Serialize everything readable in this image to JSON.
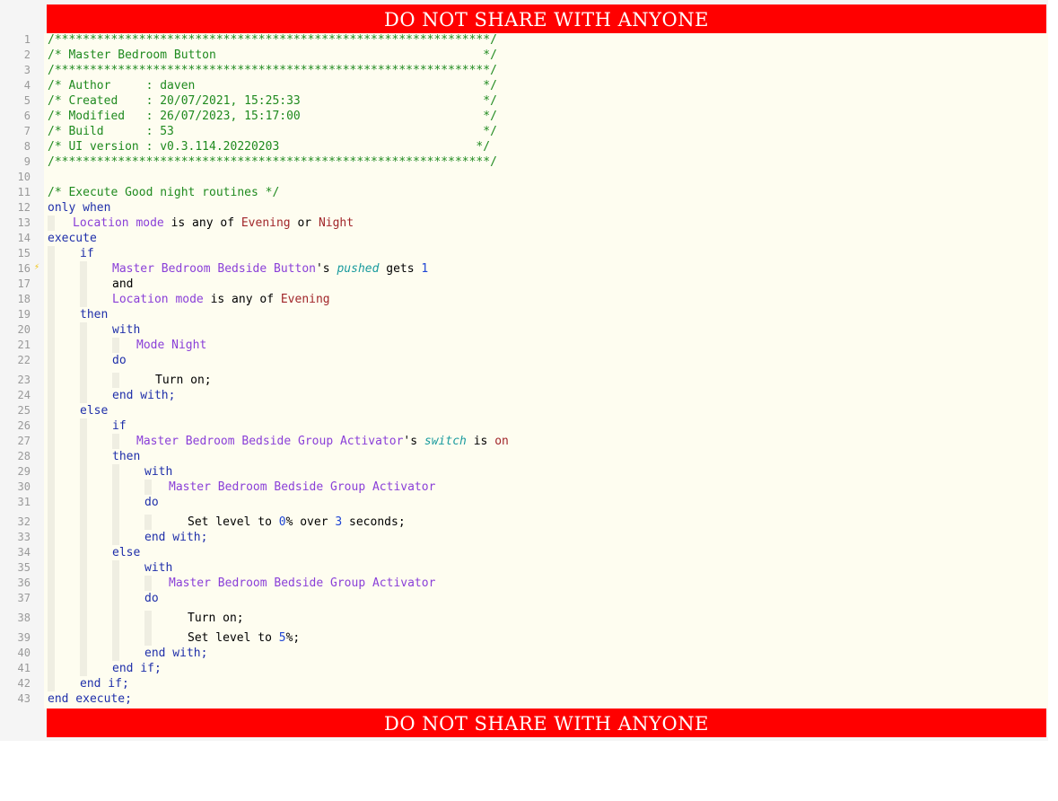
{
  "banner": {
    "top": "DO NOT SHARE WITH ANYONE",
    "bottom": "DO NOT SHARE WITH ANYONE"
  },
  "colors": {
    "banner": "#ff0000",
    "code_background": "#fefdf0",
    "comment": "#1f8a1f",
    "keyword": "#1f2faa",
    "device": "#8a3fd8",
    "value": "#a1262a",
    "attribute": "#1a9b9e",
    "number": "#1f45d4",
    "text": "#000000"
  },
  "gutter_marker": {
    "line": 16,
    "icon": "lightbulb-icon"
  },
  "lines": [
    {
      "n": "1",
      "indent": 0,
      "tokens": [
        {
          "t": "/**************************************************************/",
          "c": "com"
        }
      ]
    },
    {
      "n": "2",
      "indent": 0,
      "tokens": [
        {
          "t": "/* Master Bedroom Button                                      */",
          "c": "com"
        }
      ]
    },
    {
      "n": "3",
      "indent": 0,
      "tokens": [
        {
          "t": "/**************************************************************/",
          "c": "com"
        }
      ]
    },
    {
      "n": "4",
      "indent": 0,
      "tokens": [
        {
          "t": "/* Author     : daven                                         */",
          "c": "com"
        }
      ]
    },
    {
      "n": "5",
      "indent": 0,
      "tokens": [
        {
          "t": "/* Created    : 20/07/2021, 15:25:33                          */",
          "c": "com"
        }
      ]
    },
    {
      "n": "6",
      "indent": 0,
      "tokens": [
        {
          "t": "/* Modified   : 26/07/2023, 15:17:00                          */",
          "c": "com"
        }
      ]
    },
    {
      "n": "7",
      "indent": 0,
      "tokens": [
        {
          "t": "/* Build      : 53                                            */",
          "c": "com"
        }
      ]
    },
    {
      "n": "8",
      "indent": 0,
      "tokens": [
        {
          "t": "/* UI version : v0.3.114.20220203                            */",
          "c": "com"
        }
      ]
    },
    {
      "n": "9",
      "indent": 0,
      "tokens": [
        {
          "t": "/**************************************************************/",
          "c": "com"
        }
      ]
    },
    {
      "n": "10",
      "indent": 0,
      "tokens": []
    },
    {
      "n": "11",
      "indent": 0,
      "tokens": [
        {
          "t": "/* Execute Good night routines */",
          "c": "com"
        }
      ]
    },
    {
      "n": "12",
      "indent": 0,
      "tokens": [
        {
          "t": "only when",
          "c": "kw"
        }
      ]
    },
    {
      "n": "13",
      "indent": 1,
      "tokens": [
        {
          "t": "Location mode",
          "c": "dev"
        },
        {
          "t": " is any of ",
          "c": "txt"
        },
        {
          "t": "Evening",
          "c": "val"
        },
        {
          "t": " or ",
          "c": "txt"
        },
        {
          "t": "Night",
          "c": "val"
        }
      ]
    },
    {
      "n": "14",
      "indent": 0,
      "tokens": [
        {
          "t": "execute",
          "c": "kw"
        }
      ]
    },
    {
      "n": "15",
      "indent": 1,
      "tokens": [
        {
          "t": "if",
          "c": "kw"
        }
      ]
    },
    {
      "n": "16",
      "indent": 2,
      "tokens": [
        {
          "t": "Master Bedroom Bedside Button",
          "c": "dev"
        },
        {
          "t": "'s ",
          "c": "txt"
        },
        {
          "t": "pushed",
          "c": "attr"
        },
        {
          "t": " gets ",
          "c": "txt"
        },
        {
          "t": "1",
          "c": "num"
        }
      ]
    },
    {
      "n": "17",
      "indent": 2,
      "tokens": [
        {
          "t": "and",
          "c": "txt"
        }
      ]
    },
    {
      "n": "18",
      "indent": 2,
      "tokens": [
        {
          "t": "Location mode",
          "c": "dev"
        },
        {
          "t": " is any of ",
          "c": "txt"
        },
        {
          "t": "Evening",
          "c": "val"
        }
      ]
    },
    {
      "n": "19",
      "indent": 1,
      "tokens": [
        {
          "t": "then",
          "c": "kw"
        }
      ]
    },
    {
      "n": "20",
      "indent": 2,
      "tokens": [
        {
          "t": "with",
          "c": "kw"
        }
      ]
    },
    {
      "n": "21",
      "indent": 3,
      "tokens": [
        {
          "t": "Mode Night",
          "c": "dev"
        }
      ]
    },
    {
      "n": "22",
      "indent": 2,
      "tokens": [
        {
          "t": "do",
          "c": "kw"
        }
      ]
    },
    {
      "n": "23",
      "indent": 3,
      "tall": true,
      "tokens": [
        {
          "t": "Turn on;",
          "c": "txt"
        }
      ]
    },
    {
      "n": "24",
      "indent": 2,
      "tokens": [
        {
          "t": "end with;",
          "c": "kw"
        }
      ]
    },
    {
      "n": "25",
      "indent": 1,
      "tokens": [
        {
          "t": "else",
          "c": "kw"
        }
      ]
    },
    {
      "n": "26",
      "indent": 2,
      "tokens": [
        {
          "t": "if",
          "c": "kw"
        }
      ]
    },
    {
      "n": "27",
      "indent": 3,
      "tokens": [
        {
          "t": "Master Bedroom Bedside Group Activator",
          "c": "dev"
        },
        {
          "t": "'s ",
          "c": "txt"
        },
        {
          "t": "switch",
          "c": "attr"
        },
        {
          "t": " is ",
          "c": "txt"
        },
        {
          "t": "on",
          "c": "val"
        }
      ]
    },
    {
      "n": "28",
      "indent": 2,
      "tokens": [
        {
          "t": "then",
          "c": "kw"
        }
      ]
    },
    {
      "n": "29",
      "indent": 3,
      "tokens": [
        {
          "t": "with",
          "c": "kw"
        }
      ]
    },
    {
      "n": "30",
      "indent": 4,
      "tokens": [
        {
          "t": "Master Bedroom Bedside Group Activator",
          "c": "dev"
        }
      ]
    },
    {
      "n": "31",
      "indent": 3,
      "tokens": [
        {
          "t": "do",
          "c": "kw"
        }
      ]
    },
    {
      "n": "32",
      "indent": 4,
      "tall": true,
      "tokens": [
        {
          "t": "Set level to ",
          "c": "txt"
        },
        {
          "t": "0",
          "c": "num"
        },
        {
          "t": "% over ",
          "c": "txt"
        },
        {
          "t": "3",
          "c": "num"
        },
        {
          "t": " seconds;",
          "c": "txt"
        }
      ]
    },
    {
      "n": "33",
      "indent": 3,
      "tokens": [
        {
          "t": "end with;",
          "c": "kw"
        }
      ]
    },
    {
      "n": "34",
      "indent": 2,
      "tokens": [
        {
          "t": "else",
          "c": "kw"
        }
      ]
    },
    {
      "n": "35",
      "indent": 3,
      "tokens": [
        {
          "t": "with",
          "c": "kw"
        }
      ]
    },
    {
      "n": "36",
      "indent": 4,
      "tokens": [
        {
          "t": "Master Bedroom Bedside Group Activator",
          "c": "dev"
        }
      ]
    },
    {
      "n": "37",
      "indent": 3,
      "tokens": [
        {
          "t": "do",
          "c": "kw"
        }
      ]
    },
    {
      "n": "38",
      "indent": 4,
      "tall": true,
      "tokens": [
        {
          "t": "Turn on;",
          "c": "txt"
        }
      ]
    },
    {
      "n": "39",
      "indent": 4,
      "tall": true,
      "tokens": [
        {
          "t": "Set level to ",
          "c": "txt"
        },
        {
          "t": "5",
          "c": "num"
        },
        {
          "t": "%;",
          "c": "txt"
        }
      ]
    },
    {
      "n": "40",
      "indent": 3,
      "tokens": [
        {
          "t": "end with;",
          "c": "kw"
        }
      ]
    },
    {
      "n": "41",
      "indent": 2,
      "tokens": [
        {
          "t": "end if;",
          "c": "kw"
        }
      ]
    },
    {
      "n": "42",
      "indent": 1,
      "tokens": [
        {
          "t": "end if;",
          "c": "kw"
        }
      ]
    },
    {
      "n": "43",
      "indent": 0,
      "tokens": [
        {
          "t": "end execute;",
          "c": "kw"
        }
      ]
    }
  ]
}
